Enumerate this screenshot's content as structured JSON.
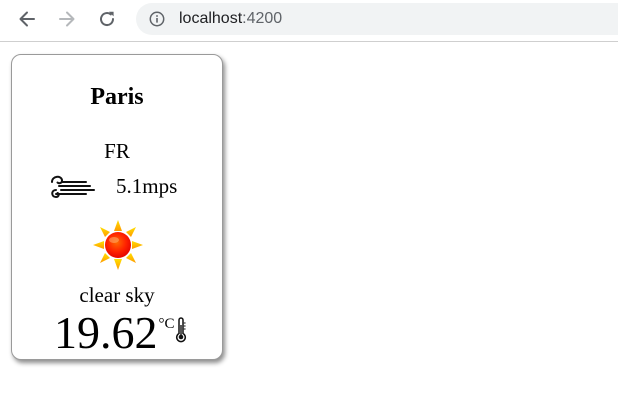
{
  "browser": {
    "url_host": "localhost",
    "url_port": ":4200",
    "icons": {
      "back": "arrow-back-icon",
      "forward": "arrow-forward-icon",
      "reload": "reload-icon",
      "info": "info-icon"
    }
  },
  "weather": {
    "city": "Paris",
    "country": "FR",
    "wind_speed": "5.1mps",
    "condition": "clear sky",
    "temperature": "19.62",
    "unit": "°C",
    "icons": {
      "wind": "wind-icon",
      "condition": "sun-icon",
      "thermometer": "thermometer-icon"
    },
    "colors": {
      "sun_center": "#ff2200",
      "sun_rays": "#ffb400"
    }
  }
}
